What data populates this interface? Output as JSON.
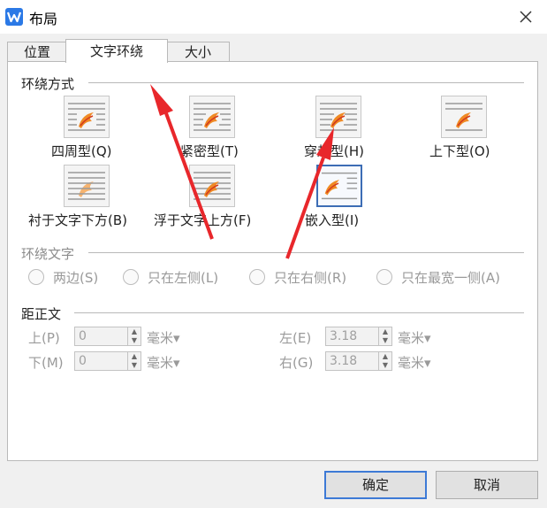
{
  "window": {
    "title": "布局",
    "app_icon": "wps-writer-icon",
    "accent": "#2b79e6"
  },
  "tabs": [
    {
      "label": "位置"
    },
    {
      "label": "文字环绕"
    },
    {
      "label": "大小"
    }
  ],
  "wrap_style": {
    "title": "环绕方式",
    "options": [
      {
        "label": "四周型(Q)",
        "icon": "wrap-square-icon"
      },
      {
        "label": "紧密型(T)",
        "icon": "wrap-tight-icon"
      },
      {
        "label": "穿越型(H)",
        "icon": "wrap-through-icon"
      },
      {
        "label": "上下型(O)",
        "icon": "wrap-top-bottom-icon"
      },
      {
        "label": "衬于文字下方(B)",
        "icon": "wrap-behind-text-icon"
      },
      {
        "label": "浮于文字上方(F)",
        "icon": "wrap-in-front-icon"
      },
      {
        "label": "嵌入型(I)",
        "icon": "wrap-inline-icon",
        "selected": true
      }
    ]
  },
  "wrap_text": {
    "title": "环绕文字",
    "options": [
      "两边(S)",
      "只在左侧(L)",
      "只在右侧(R)",
      "只在最宽一侧(A)"
    ]
  },
  "distance": {
    "title": "距正文",
    "top_label": "上(P)",
    "top_value": "0",
    "bottom_label": "下(M)",
    "bottom_value": "0",
    "left_label": "左(E)",
    "left_value": "3.18",
    "right_label": "右(G)",
    "right_value": "3.18",
    "unit": "毫米▾"
  },
  "buttons": {
    "ok": "确定",
    "cancel": "取消"
  },
  "annotation_color": "#e8272b"
}
